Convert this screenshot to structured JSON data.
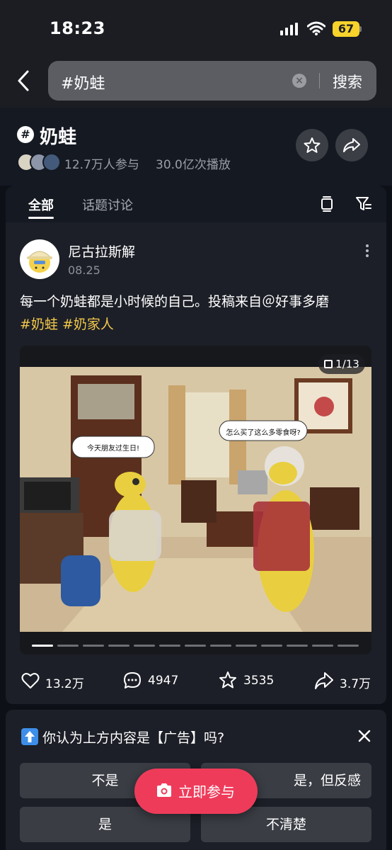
{
  "status_bar": {
    "time": "18:23",
    "battery": "67"
  },
  "search": {
    "value": "#奶蛙",
    "button_label": "搜索"
  },
  "topic": {
    "title": "奶蛙",
    "participants": "12.7万人参与",
    "plays": "30.0亿次播放"
  },
  "tabs": [
    {
      "label": "全部"
    },
    {
      "label": "话题讨论"
    }
  ],
  "post": {
    "author": "尼古拉斯解",
    "date": "08.25",
    "text": "每一个奶蛙都是小时候的自己。投稿来自＠好事多磨",
    "tags": [
      "#奶蛙",
      "#奶家人"
    ],
    "image": {
      "counter": "1/13",
      "bubble_left": "今天朋友过生日!",
      "bubble_right": "怎么买了这么多零食呀?"
    },
    "stats": {
      "likes": "13.2万",
      "comments": "4947",
      "favorites": "3535",
      "shares": "3.7万"
    }
  },
  "poll": {
    "question": "你认为上方内容是【广告】吗?",
    "options": [
      "不是",
      "是，但反感",
      "是",
      "不清楚"
    ]
  },
  "cta": {
    "label": "立即参与"
  },
  "colors": {
    "accent": "#ef3b5a",
    "tag": "#f2c74b",
    "battery": "#f7d32b"
  }
}
